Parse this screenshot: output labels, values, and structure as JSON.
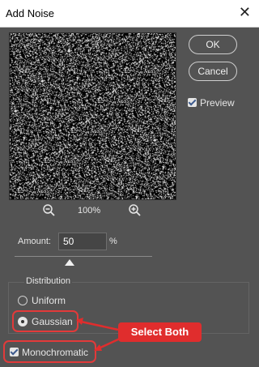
{
  "dialog": {
    "title": "Add Noise",
    "close_glyph": "✕"
  },
  "buttons": {
    "ok": "OK",
    "cancel": "Cancel"
  },
  "preview": {
    "label": "Preview",
    "checked": true
  },
  "zoom": {
    "level": "100%"
  },
  "amount": {
    "label": "Amount:",
    "value": "50",
    "unit": "%"
  },
  "distribution": {
    "label": "Distribution",
    "options": [
      {
        "label": "Uniform",
        "selected": false
      },
      {
        "label": "Gaussian",
        "selected": true
      }
    ]
  },
  "monochromatic": {
    "label": "Monochromatic",
    "checked": true
  },
  "annotation": {
    "callout": "Select Both",
    "color": "#e02d2d"
  },
  "icons": {
    "zoom_out": "zoom-out-icon",
    "zoom_in": "zoom-in-icon",
    "close": "close-icon"
  }
}
